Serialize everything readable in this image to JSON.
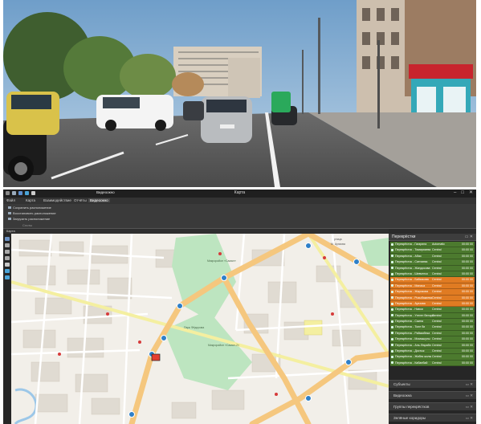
{
  "app": {
    "window_title": "Карта",
    "ribbon_tab_title": "Видеоокно",
    "menu": [
      {
        "label": "Файл",
        "active": false
      },
      {
        "label": "Карта",
        "active": false
      },
      {
        "label": "Взаимодействие",
        "active": false
      },
      {
        "label": "Отчёты",
        "active": false
      },
      {
        "label": "Видеоокно",
        "active": true
      }
    ],
    "ribbon_items": [
      "Сохранить расположение",
      "Восстановить расположение",
      "Загрузить расположение"
    ],
    "ribbon_group_label": "Слоты",
    "map_tab_label": "Карта",
    "window_controls": {
      "minimize": "–",
      "maximize": "□",
      "close": "✕"
    }
  },
  "map": {
    "labels": {
      "district_1": "Микрорайон «Самал»",
      "district_2": "Микрорайон «Самал-2»",
      "park": "Парк Фёдорова",
      "street_top": "М. Ауэзова",
      "street_top_2": "улица"
    }
  },
  "right_panel": {
    "title": "Перекрёстки",
    "controls": "▭ ✕",
    "rows": [
      {
        "name": "Перекрёсток - Гагарина",
        "mode": "Automatic",
        "time": "00:00 00",
        "color": "#4c7a2e"
      },
      {
        "name": "Перекрёсток - Тимирязева",
        "mode": "Central",
        "time": "00:00 00",
        "color": "#4c7a2e"
      },
      {
        "name": "Перекрёсток - Абая",
        "mode": "Central",
        "time": "00:00 00",
        "color": "#4c7a2e"
      },
      {
        "name": "Перекрёсток - Сатпаева",
        "mode": "Central",
        "time": "00:00 00",
        "color": "#4c7a2e"
      },
      {
        "name": "Перекрёсток - Жандосова",
        "mode": "Central",
        "time": "00:00 00",
        "color": "#4c7a2e"
      },
      {
        "name": "Перекрёсток - Шевченко",
        "mode": "Central",
        "time": "00:00 00",
        "color": "#4c7a2e"
      },
      {
        "name": "Перекрёсток - Байзакова",
        "mode": "Central",
        "time": "00:00 00",
        "color": "#e07b22"
      },
      {
        "name": "Перекрёсток - Манаса",
        "mode": "Central",
        "time": "00:00 00",
        "color": "#e07b22"
      },
      {
        "name": "Перекрёсток - Жарокова",
        "mode": "Central",
        "time": "00:00 00",
        "color": "#e07b22"
      },
      {
        "name": "Перекрёсток - Розыбакиева",
        "mode": "Central",
        "time": "00:00 00",
        "color": "#e07b22"
      },
      {
        "name": "Перекрёсток - Ауэзова",
        "mode": "Central",
        "time": "00:00 00",
        "color": "#e07b22"
      },
      {
        "name": "Перекрёсток - Навои",
        "mode": "Central",
        "time": "00:00 00",
        "color": "#4c7a2e"
      },
      {
        "name": "Перекрёсток - Утеген батыра",
        "mode": "Central",
        "time": "00:00 00",
        "color": "#4c7a2e"
      },
      {
        "name": "Перекрёсток - Саина",
        "mode": "Central",
        "time": "00:00 00",
        "color": "#4c7a2e"
      },
      {
        "name": "Перекрёсток - Толе би",
        "mode": "Central",
        "time": "00:00 00",
        "color": "#4c7a2e"
      },
      {
        "name": "Перекрёсток - Райымбека",
        "mode": "Central",
        "time": "00:00 00",
        "color": "#4c7a2e"
      },
      {
        "name": "Перекрёсток - Момышулы",
        "mode": "Central",
        "time": "00:00 00",
        "color": "#4c7a2e"
      },
      {
        "name": "Перекрёсток - Аль-Фараби",
        "mode": "Central",
        "time": "00:00 00",
        "color": "#4c7a2e"
      },
      {
        "name": "Перекрёсток - Достык",
        "mode": "Central",
        "time": "00:00 00",
        "color": "#4c7a2e"
      },
      {
        "name": "Перекрёсток - Жибек жолы",
        "mode": "Central",
        "time": "00:00 00",
        "color": "#4c7a2e"
      },
      {
        "name": "Перекрёсток - Кабанбай",
        "mode": "Central",
        "time": "00:00 00",
        "color": "#4c7a2e"
      }
    ],
    "sections": [
      {
        "title": "Субъекты",
        "controls": "▭ ✕"
      },
      {
        "title": "Видеоокна",
        "controls": "▭ ✕"
      },
      {
        "title": "Группы перекрёстков",
        "controls": "▭ ✕"
      },
      {
        "title": "Зелёные коридоры",
        "controls": "▭ ✕"
      }
    ]
  },
  "colors": {
    "ui_dark": "#2b2b2b",
    "status_green": "#4c7a2e",
    "status_orange": "#e07b22",
    "road_major": "#f5c77e",
    "road_yellow": "#f4efa0",
    "park_green": "#bde5c0"
  }
}
